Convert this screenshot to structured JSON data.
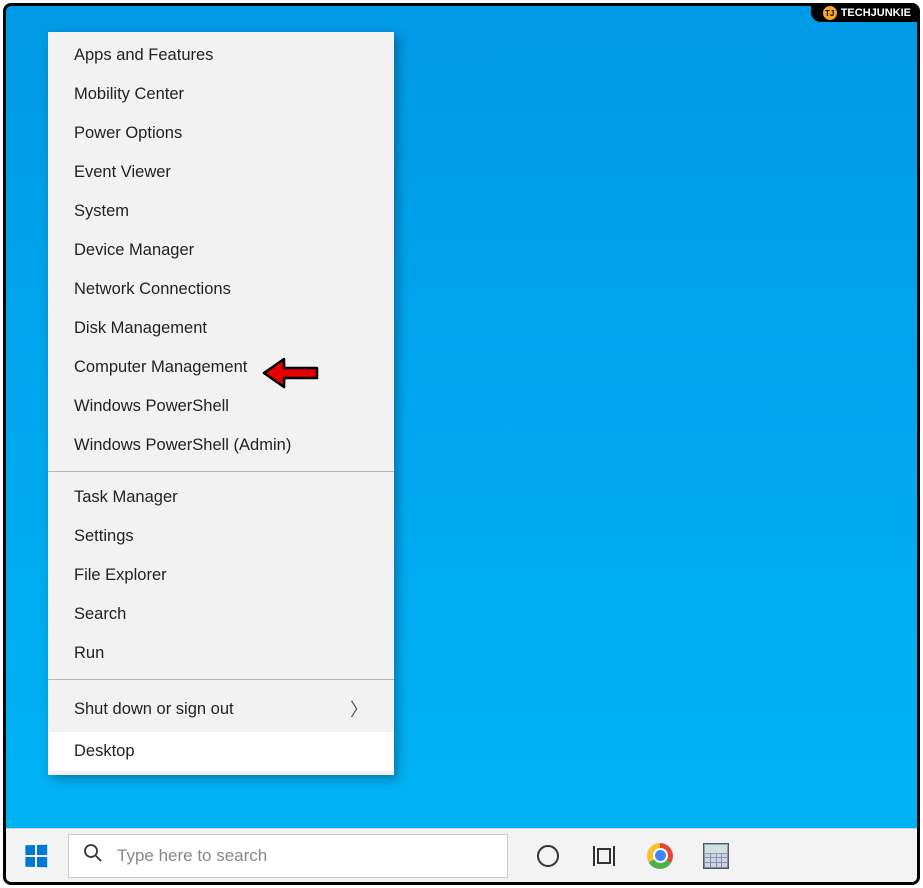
{
  "watermark": {
    "logo_text": "TJ",
    "text": "TECHJUNKIE"
  },
  "context_menu": {
    "groups": [
      {
        "items": [
          {
            "label": "Apps and Features",
            "name": "menu-apps-and-features"
          },
          {
            "label": "Mobility Center",
            "name": "menu-mobility-center"
          },
          {
            "label": "Power Options",
            "name": "menu-power-options"
          },
          {
            "label": "Event Viewer",
            "name": "menu-event-viewer"
          },
          {
            "label": "System",
            "name": "menu-system"
          },
          {
            "label": "Device Manager",
            "name": "menu-device-manager"
          },
          {
            "label": "Network Connections",
            "name": "menu-network-connections"
          },
          {
            "label": "Disk Management",
            "name": "menu-disk-management",
            "highlighted": true
          },
          {
            "label": "Computer Management",
            "name": "menu-computer-management"
          },
          {
            "label": "Windows PowerShell",
            "name": "menu-windows-powershell"
          },
          {
            "label": "Windows PowerShell (Admin)",
            "name": "menu-windows-powershell-admin"
          }
        ]
      },
      {
        "items": [
          {
            "label": "Task Manager",
            "name": "menu-task-manager"
          },
          {
            "label": "Settings",
            "name": "menu-settings"
          },
          {
            "label": "File Explorer",
            "name": "menu-file-explorer"
          },
          {
            "label": "Search",
            "name": "menu-search"
          },
          {
            "label": "Run",
            "name": "menu-run"
          }
        ]
      },
      {
        "items": [
          {
            "label": "Shut down or sign out",
            "name": "menu-shut-down-or-sign-out",
            "submenu": true
          },
          {
            "label": "Desktop",
            "name": "menu-desktop",
            "selected": true
          }
        ]
      }
    ]
  },
  "taskbar": {
    "search_placeholder": "Type here to search"
  }
}
